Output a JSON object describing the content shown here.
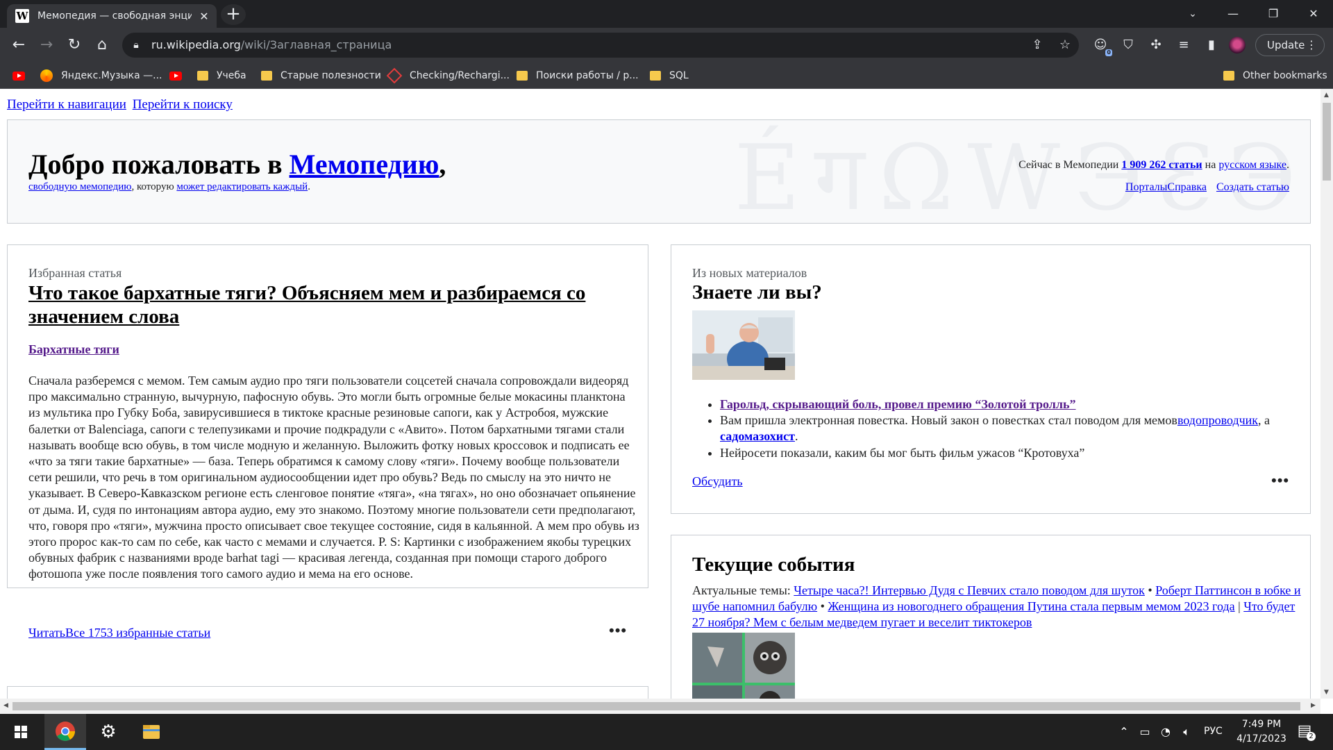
{
  "browser": {
    "tab_title": "Мемопедия — свободная энциклопедия",
    "tab_favicon": "W",
    "url_host": "ru.wikipedia.org",
    "url_path": "/wiki/Заглавная_страница",
    "update_label": "Update",
    "extension_badge": "0",
    "bookmarks": [
      {
        "label": "",
        "icon": "youtube-icon"
      },
      {
        "label": "Яндекс.Музыка —...",
        "icon": "yandex-music-icon"
      },
      {
        "label": "",
        "icon": "youtube-icon"
      },
      {
        "label": "Учеба",
        "icon": "folder-icon"
      },
      {
        "label": "Старые полезности",
        "icon": "folder-icon"
      },
      {
        "label": "Checking/Rechargi...",
        "icon": "diamond-icon"
      },
      {
        "label": "Поиски работы / р...",
        "icon": "folder-icon"
      },
      {
        "label": "SQL",
        "icon": "folder-icon"
      }
    ],
    "other_bookmarks": "Other bookmarks"
  },
  "page": {
    "skip_nav": "Перейти к навигации",
    "skip_search": "Перейти к поиску",
    "welcome_prefix": "Добро пожаловать в ",
    "welcome_link": "Мемопедию",
    "welcome_suffix": ",",
    "sub_link1": "свободную мемопедию",
    "sub_text": ", которую ",
    "sub_link2": "может редактировать каждый",
    "sub_end": ".",
    "stats_prefix": "Сейчас в Мемопедии ",
    "stats_count": "1 909 262 статьи",
    "stats_mid": " на ",
    "stats_lang": "русском языке",
    "stats_end": ".",
    "portals": "Порталы",
    "help": "Справка",
    "create_article": "Создать статью",
    "featured": {
      "label": "Избранная статья",
      "title": "Что такое бархатные тяги? Объясняем мем и разбираемся со значением слова",
      "link": "Бархатные тяги",
      "text": "Сначала разберемся с мемом. Тем самым аудио про тяги пользователи соцсетей сначала сопровождали видеоряд про максимально странную, вычурную, пафосную обувь. Это могли быть огромные белые мокасины планктона из мультика про Губку Боба, завирусившиеся в тиктоке красные резиновые сапоги, как у Астробоя, мужские балетки от Balenciaga, сапоги с телепузиками и прочие подкрадули с «Авито». Потом бархатными тягами стали называть вообще всю обувь, в том числе модную и желанную. Выложить фотку новых кроссовок и подписать ее «что за тяги такие бархатные» — база. Теперь обратимся к самому слову «тяги». Почему вообще пользователи сети решили, что речь в том оригинальном аудиосообщении идет про обувь? Ведь по смыслу на это ничто не указывает. В Северо-Кавказском регионе есть сленговое понятие «тяга», «на тягах», но оно обозначает опьянение от дыма. И, судя по интонациям автора аудио, ему это знакомо. Поэтому многие пользователи сети предполагают, что, говоря про «тяги», мужчина просто описывает свое текущее состояние, сидя в кальянной. А мем про обувь из этого пророс как-то сам по себе, как часто с мемами и случается. P. S: Картинки с изображением якобы турецких обувных фабрик с названиями вроде barhat tagi — красивая легенда, созданная при помощи старого доброго фотошопа уже после появления того самого аудио и мема на его основе.",
      "read": "Читать",
      "all": "Все 1753 избранные статьи"
    },
    "dyk": {
      "label": "Из новых материалов",
      "title": "Знаете ли вы?",
      "item1": "Гарольд, скрывающий боль, провел премию “Золотой тролль”",
      "item2_text": "Вам пришла электронная повестка. Новый закон о повестках стал поводом для мемов",
      "item2_link1": "водопроводчик",
      "item2_mid": ", а ",
      "item2_link2": "садомазохист",
      "item2_end": ".",
      "item3": "Нейросети показали, каким бы мог быть фильм ужасов “Кротовуха”",
      "discuss": "Обсудить"
    },
    "news": {
      "title": "Текущие события",
      "prefix": "Актуальные темы: ",
      "topic1": "Четыре часа?! Интервью Дудя с Певчих стало поводом для шуток",
      "sep1": " • ",
      "topic2": "Роберт Паттинсон в юбке и шубе напомнил бабулю",
      "sep2": " • ",
      "topic3": "Женщина из новогоднего обращения Путина стала первым мемом 2023 года",
      "sep3": " | ",
      "topic4": "Что будет 27 ноября? Мем с белым медведем пугает и веселит тиктокеров"
    },
    "dots": "•••"
  },
  "taskbar": {
    "language": "РУС",
    "time": "7:49 PM",
    "date": "4/17/2023",
    "notification_count": "2"
  }
}
